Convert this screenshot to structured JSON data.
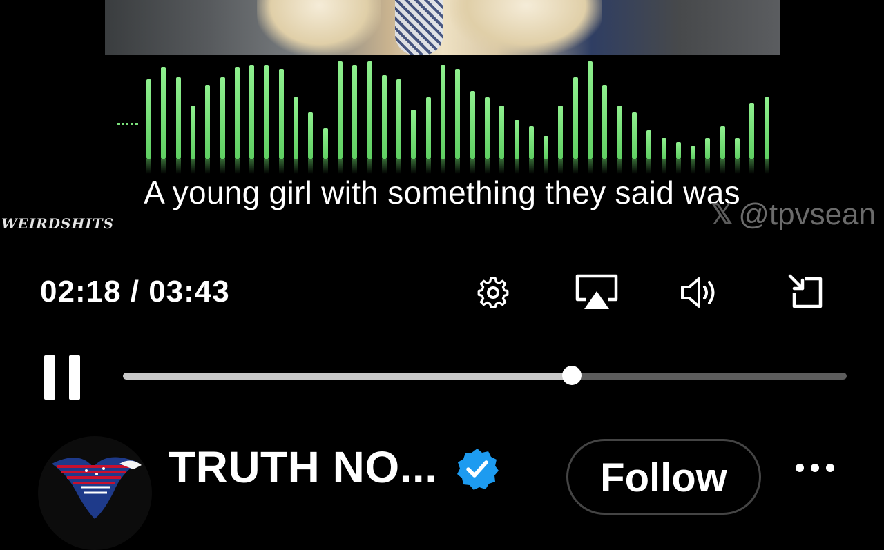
{
  "video": {
    "subtitle": "A young girl with something they said was",
    "watermark_left": "WEIRDSHITS",
    "watermark_right": "@tpvsean"
  },
  "waveform": {
    "color": "#7be07b",
    "levels": [
      0.78,
      0.9,
      0.8,
      0.52,
      0.72,
      0.8,
      0.9,
      0.92,
      0.92,
      0.88,
      0.6,
      0.45,
      0.3,
      0.95,
      0.92,
      0.95,
      0.82,
      0.78,
      0.48,
      0.6,
      0.92,
      0.88,
      0.66,
      0.6,
      0.52,
      0.38,
      0.32,
      0.22,
      0.52,
      0.8,
      0.95,
      0.72,
      0.52,
      0.45,
      0.28,
      0.2,
      0.16,
      0.12,
      0.2,
      0.32,
      0.2,
      0.55,
      0.6
    ]
  },
  "player": {
    "current_time": "02:18",
    "total_time": "03:43",
    "time_display": "02:18 / 03:43",
    "progress": 0.62,
    "state": "playing"
  },
  "icons": {
    "settings": "gear-icon",
    "airplay": "airplay-icon",
    "volume": "volume-icon",
    "minimize": "minimize-icon",
    "pause": "pause-icon",
    "verified": "verified-badge-icon",
    "more": "more-icon"
  },
  "account": {
    "name": "TRUTH NO...",
    "follow_label": "Follow",
    "verified_color": "#1d9bf0"
  }
}
